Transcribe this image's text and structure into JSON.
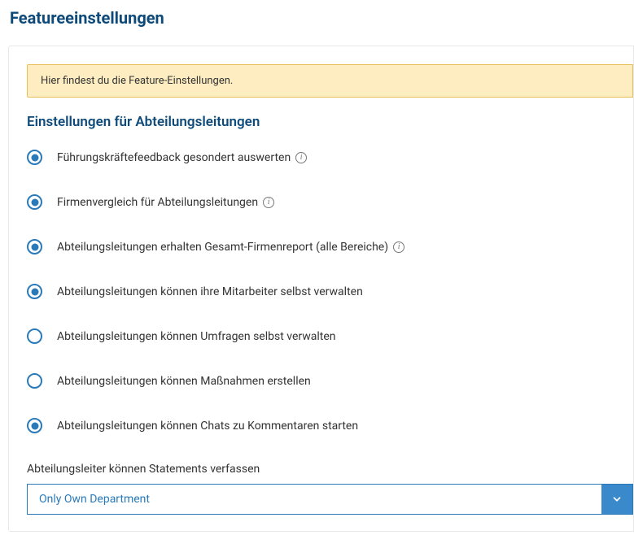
{
  "page_title": "Featureeinstellungen",
  "info_banner": "Hier findest du die Feature-Einstellungen.",
  "section_title": "Einstellungen für Abteilungsleitungen",
  "options": [
    {
      "label": "Führungskräftefeedback gesondert auswerten",
      "selected": true,
      "info": true
    },
    {
      "label": "Firmenvergleich für Abteilungsleitungen",
      "selected": true,
      "info": true
    },
    {
      "label": "Abteilungsleitungen erhalten Gesamt-Firmenreport (alle Bereiche)",
      "selected": true,
      "info": true
    },
    {
      "label": "Abteilungsleitungen können ihre Mitarbeiter selbst verwalten",
      "selected": true,
      "info": false
    },
    {
      "label": "Abteilungsleitungen können Umfragen selbst verwalten",
      "selected": false,
      "info": false
    },
    {
      "label": "Abteilungsleitungen können Maßnahmen erstellen",
      "selected": false,
      "info": false
    },
    {
      "label": "Abteilungsleitungen können Chats zu Kommentaren starten",
      "selected": true,
      "info": false
    }
  ],
  "select": {
    "label": "Abteilungsleiter können Statements verfassen",
    "value": "Only Own Department"
  }
}
